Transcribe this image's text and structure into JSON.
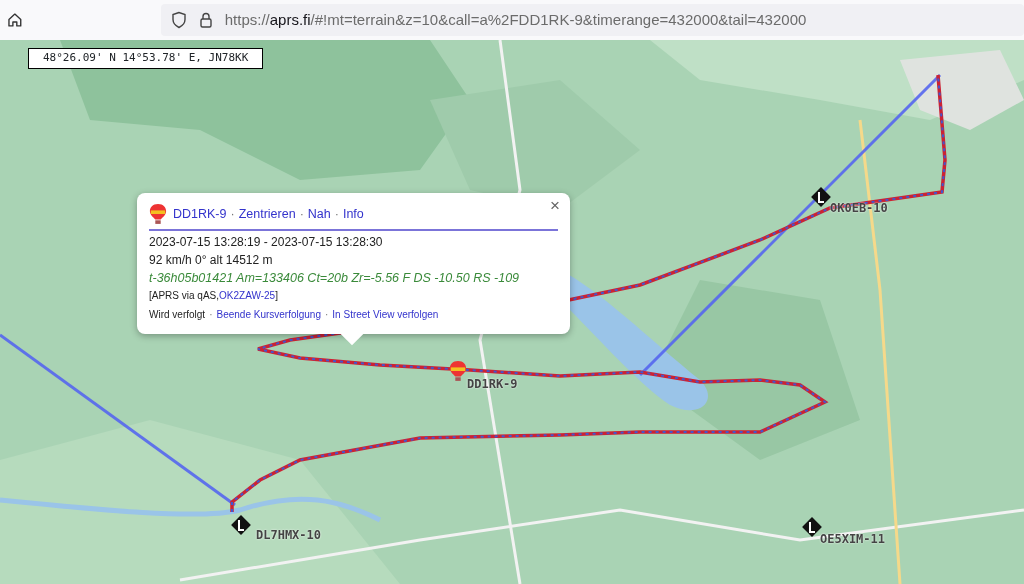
{
  "browser": {
    "url": "https://**aprs.fi**/#!mt=terrain&z=10&call=a%2FDD1RK-9&timerange=432000&tail=432000"
  },
  "map": {
    "cursor_position": "48°26.09' N 14°53.78' E, JN78KK",
    "stations": [
      {
        "label": "DD1RK-9",
        "kind": "balloon"
      },
      {
        "label": "OK0EB-10",
        "kind": "diamond"
      },
      {
        "label": "DL7HMX-10",
        "kind": "diamond"
      },
      {
        "label": "OE5XIM-11",
        "kind": "diamond"
      }
    ]
  },
  "popup": {
    "separator": "·",
    "callsign": "DD1RK-9",
    "actions": [
      "Zentrieren",
      "Nah",
      "Info"
    ],
    "time_range": "2023-07-15 13:28:19 - 2023-07-15 13:28:30",
    "motion": "92 km/h 0° alt 14512 m",
    "comment": "t-36h05b01421 Am=133406 Ct=20b Zr=-5.56 F DS -10.50 RS -109",
    "path_prefix": "[APRS via qAS,",
    "path_link": "OK2ZAW-25",
    "path_suffix": "]",
    "tracking_label": "Wird verfolgt",
    "tracking_links": [
      "Beende Kursverfolgung",
      "In Street View verfolgen"
    ],
    "close": "×"
  }
}
